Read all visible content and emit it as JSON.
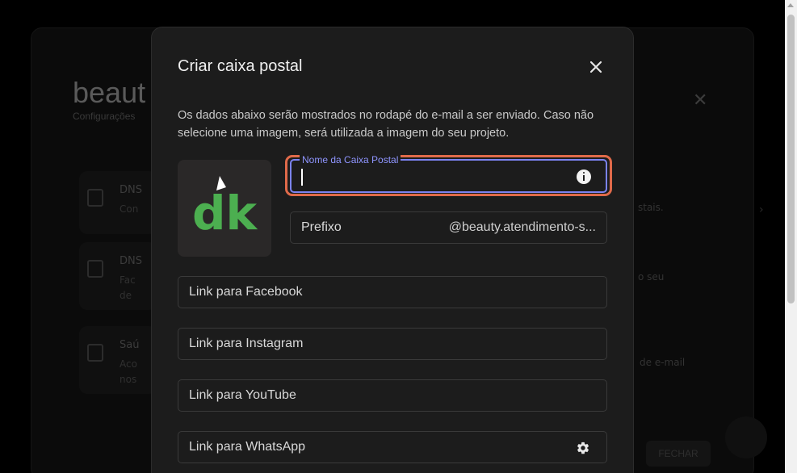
{
  "background": {
    "title": "beaut",
    "subtitle": "Configurações",
    "cards": [
      {
        "title": "DNS",
        "desc": "Con"
      },
      {
        "title": "DNS",
        "desc": "Fac\nde"
      },
      {
        "title": "Saú",
        "desc": "Aco\nnos"
      }
    ],
    "right_texts": [
      "stais.",
      "o seu",
      "de e-mail"
    ],
    "fechar_label": "FECHAR"
  },
  "modal": {
    "title": "Criar caixa postal",
    "description": "Os dados abaixo serão mostrados no rodapé do e-mail a ser enviado. Caso não selecione uma imagem, será utilizada a imagem do seu projeto.",
    "logo_text": "dk",
    "mailbox_name": {
      "label": "Nome da Caixa Postal",
      "value": ""
    },
    "prefix": {
      "label": "Prefixo",
      "suffix": "@beauty.atendimento-s..."
    },
    "facebook": {
      "label": "Link para Facebook"
    },
    "instagram": {
      "label": "Link para Instagram"
    },
    "youtube": {
      "label": "Link para YouTube"
    },
    "whatsapp": {
      "label": "Link para WhatsApp"
    }
  },
  "colors": {
    "accent_focus": "#7b83f2",
    "focus_ring": "#e06a4a",
    "logo_green": "#4caf50",
    "modal_bg": "#1c1c1c"
  },
  "icons": {
    "close": "close-icon",
    "info": "info-icon",
    "settings": "gear-icon"
  }
}
